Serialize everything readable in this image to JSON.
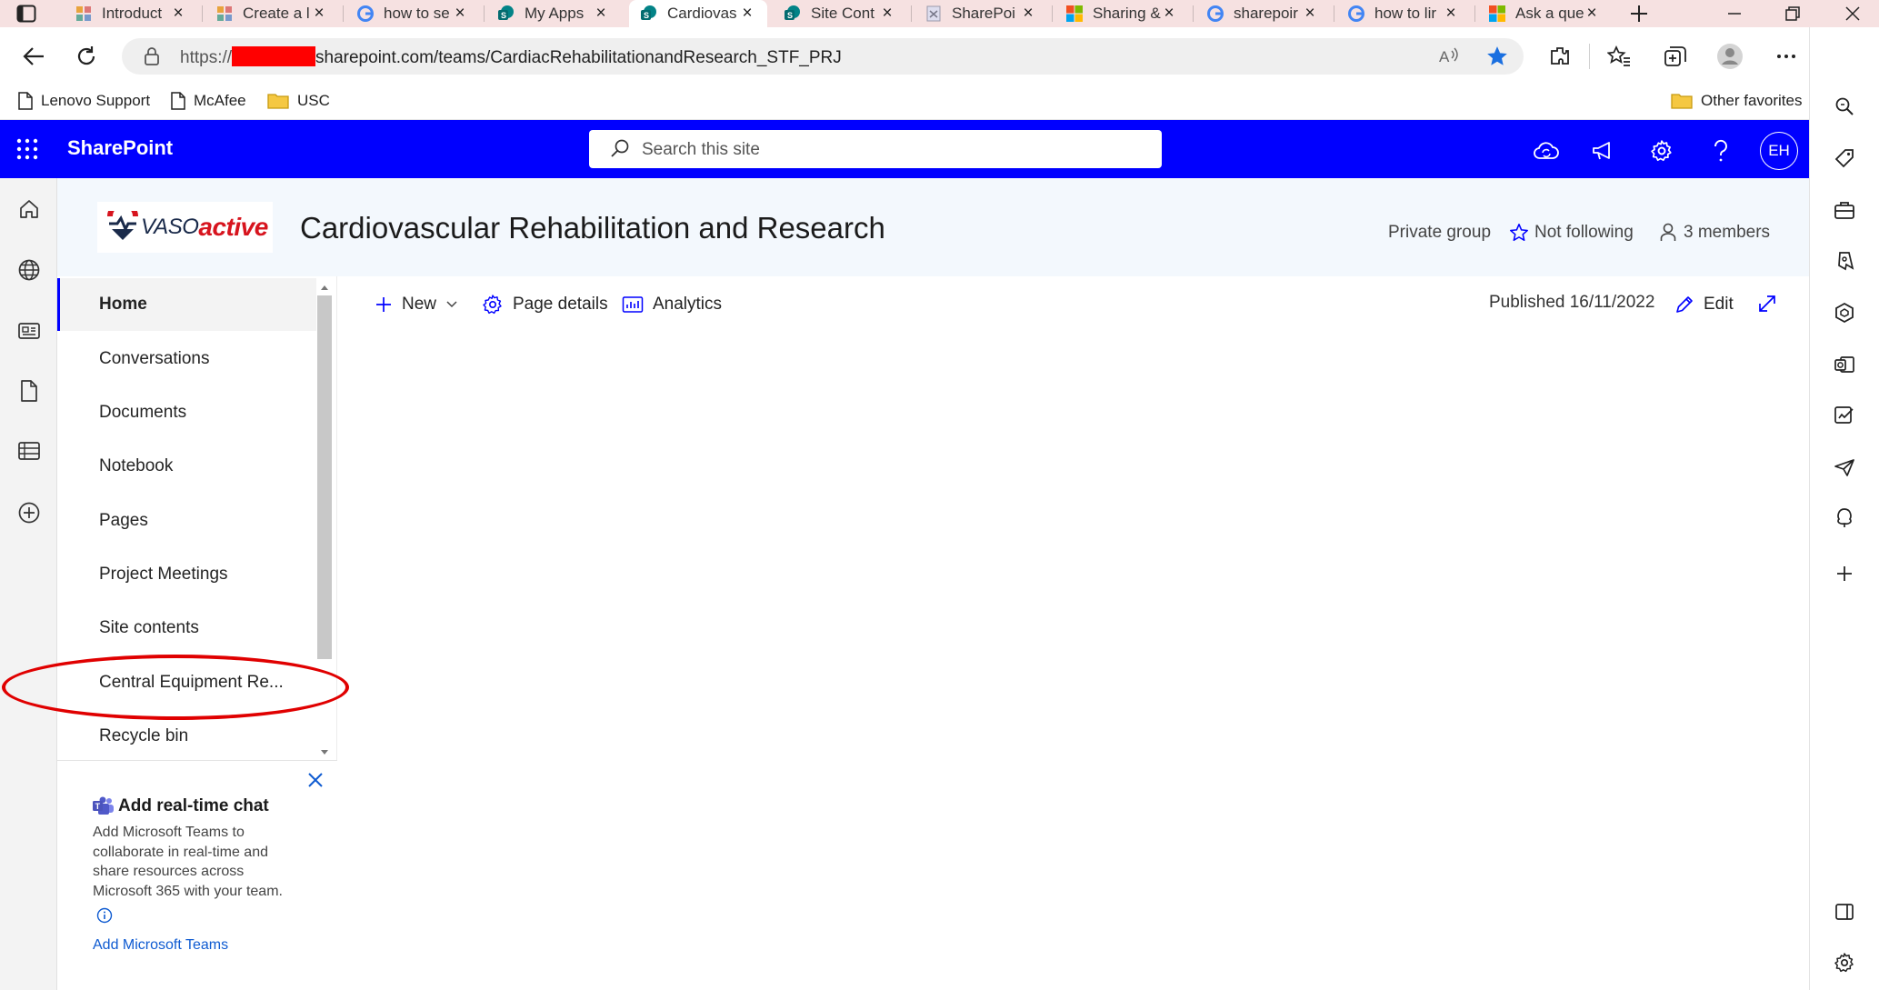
{
  "browser": {
    "tabs": [
      {
        "label": "Introduct",
        "icon": "app-icon"
      },
      {
        "label": "Create a l",
        "icon": "app-icon"
      },
      {
        "label": "how to se",
        "icon": "google-icon"
      },
      {
        "label": "My Apps",
        "icon": "sharepoint-icon"
      },
      {
        "label": "Cardiovas",
        "icon": "sharepoint-icon",
        "active": true
      },
      {
        "label": "Site Cont",
        "icon": "sharepoint-icon"
      },
      {
        "label": "SharePoi",
        "icon": "page-icon"
      },
      {
        "label": "Sharing &",
        "icon": "microsoft-icon"
      },
      {
        "label": "sharepoir",
        "icon": "google-icon"
      },
      {
        "label": "how to lir",
        "icon": "google-icon"
      },
      {
        "label": "Ask a que",
        "icon": "microsoft-icon"
      }
    ],
    "url": {
      "prefix": "https://",
      "domain": "sharepoint.com/teams/CardiacRehabilitationandResearch_STF_PRJ"
    },
    "favorites": [
      {
        "label": "Lenovo Support"
      },
      {
        "label": "McAfee"
      },
      {
        "label": "USC"
      }
    ],
    "other_favorites": "Other favorites"
  },
  "suite": {
    "brand": "SharePoint",
    "search_placeholder": "Search this site",
    "avatar_initials": "EH"
  },
  "site": {
    "logo_part1": "VASO",
    "logo_part2": "active",
    "title": "Cardiovascular Rehabilitation and Research",
    "group_type": "Private group",
    "follow_label": "Not following",
    "members_label": "3 members"
  },
  "nav": {
    "items": [
      {
        "label": "Home",
        "selected": true
      },
      {
        "label": "Conversations"
      },
      {
        "label": "Documents"
      },
      {
        "label": "Notebook"
      },
      {
        "label": "Pages"
      },
      {
        "label": "Project Meetings"
      },
      {
        "label": "Site contents"
      },
      {
        "label": "Central Equipment Re..."
      },
      {
        "label": "Recycle bin"
      }
    ]
  },
  "teams": {
    "title": "Add real-time chat",
    "body": "Add Microsoft Teams to collaborate in real-time and share resources across Microsoft 365 with your team.",
    "link": "Add Microsoft Teams"
  },
  "commandbar": {
    "new_label": "New",
    "page_details_label": "Page details",
    "analytics_label": "Analytics",
    "published": "Published 16/11/2022",
    "edit_label": "Edit"
  },
  "colors": {
    "suite_bar": "#0000ff",
    "tab_strip": "#f6e1e1",
    "annotation": "#e00000",
    "link": "#0f5bd1"
  }
}
